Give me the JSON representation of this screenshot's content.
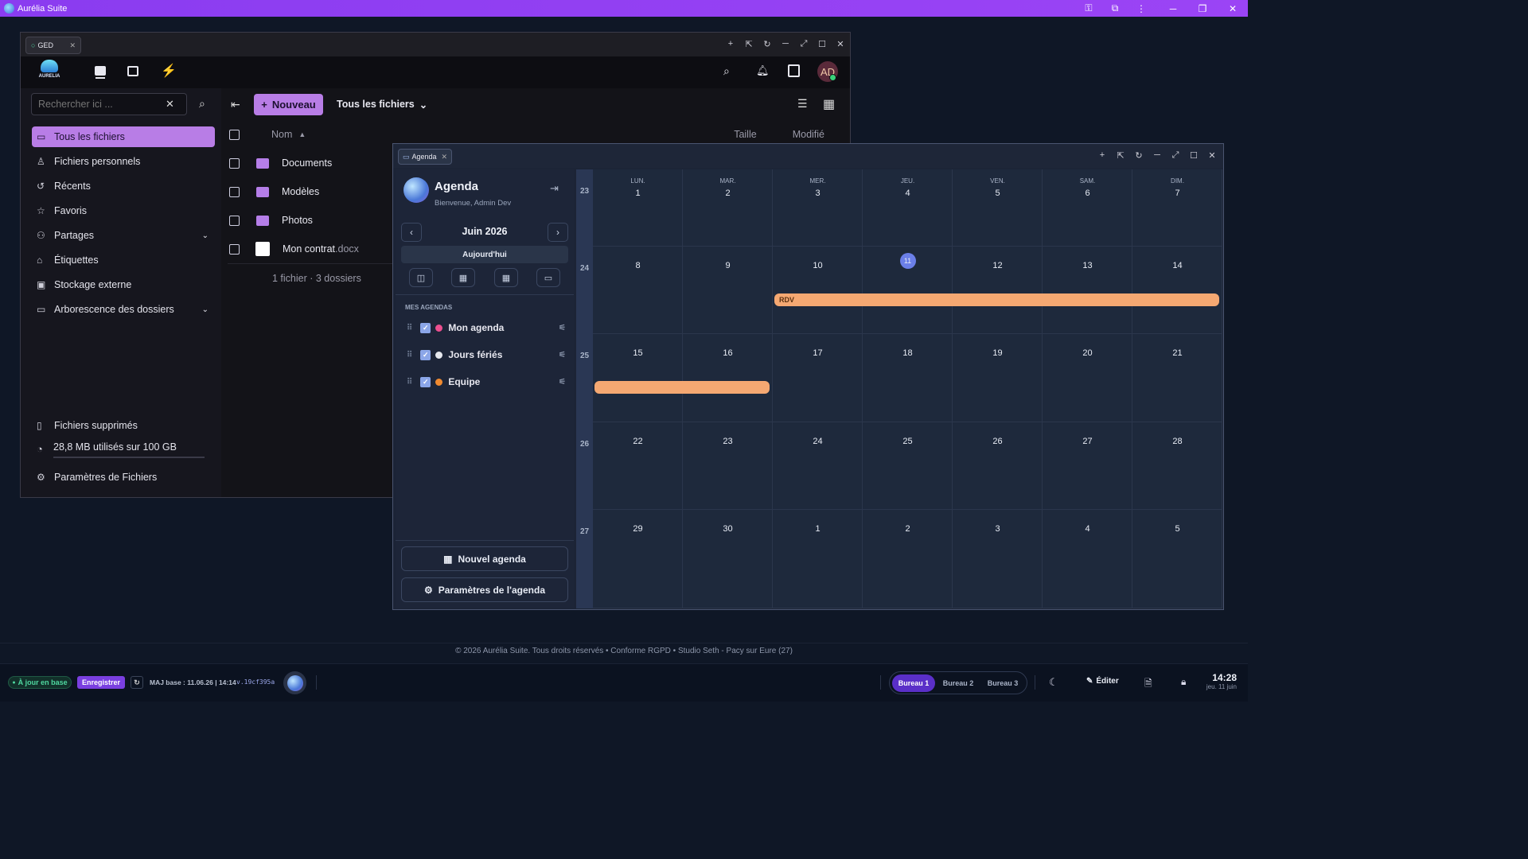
{
  "app": {
    "title": "Aurélia Suite"
  },
  "ged": {
    "tab_label": "GED",
    "brand": "AURELIA",
    "avatar": "AD",
    "search_placeholder": "Rechercher ici ...",
    "new_button": "Nouveau",
    "view_label": "Tous les fichiers",
    "nav": [
      {
        "label": "Tous les fichiers",
        "icon": "folder-icon"
      },
      {
        "label": "Fichiers personnels",
        "icon": "user-icon"
      },
      {
        "label": "Récents",
        "icon": "history-icon"
      },
      {
        "label": "Favoris",
        "icon": "star-icon"
      },
      {
        "label": "Partages",
        "icon": "share-icon"
      },
      {
        "label": "Étiquettes",
        "icon": "tag-icon"
      },
      {
        "label": "Stockage externe",
        "icon": "monitor-icon"
      },
      {
        "label": "Arborescence des dossiers",
        "icon": "folders-icon"
      }
    ],
    "trash_label": "Fichiers supprimés",
    "storage_label": "28,8 MB utilisés sur 100 GB",
    "storage_used_fraction": 0.0003,
    "settings_label": "Paramètres de Fichiers",
    "columns": {
      "name": "Nom",
      "size": "Taille",
      "modified": "Modifié"
    },
    "files": [
      {
        "name": "Documents",
        "ext": "",
        "type": "folder"
      },
      {
        "name": "Modèles",
        "ext": "",
        "type": "folder"
      },
      {
        "name": "Photos",
        "ext": "",
        "type": "folder"
      },
      {
        "name": "Mon contrat",
        "ext": ".docx",
        "type": "file"
      }
    ],
    "summary": "1 fichier · 3 dossiers"
  },
  "agenda": {
    "tab_label": "Agenda",
    "title": "Agenda",
    "welcome": "Bienvenue, Admin Dev",
    "month": "Juin 2026",
    "today_button": "Aujourd'hui",
    "section_label": "MES AGENDAS",
    "calendars": [
      {
        "name": "Mon agenda",
        "color": "#ec4f8f"
      },
      {
        "name": "Jours fériés",
        "color": "#e6e8ee"
      },
      {
        "name": "Equipe",
        "color": "#f08a30"
      }
    ],
    "new_button": "Nouvel agenda",
    "settings_button": "Paramètres de l'agenda",
    "weekdays": [
      "LUN.",
      "MAR.",
      "MER.",
      "JEU.",
      "VEN.",
      "SAM.",
      "DIM."
    ],
    "weeks": [
      {
        "num": "23",
        "days": [
          "1",
          "2",
          "3",
          "4",
          "5",
          "6",
          "7"
        ]
      },
      {
        "num": "24",
        "days": [
          "8",
          "9",
          "10",
          "11",
          "12",
          "13",
          "14"
        ]
      },
      {
        "num": "25",
        "days": [
          "15",
          "16",
          "17",
          "18",
          "19",
          "20",
          "21"
        ]
      },
      {
        "num": "26",
        "days": [
          "22",
          "23",
          "24",
          "25",
          "26",
          "27",
          "28"
        ]
      },
      {
        "num": "27",
        "days": [
          "29",
          "30",
          "1",
          "2",
          "3",
          "4",
          "5"
        ]
      }
    ],
    "today": "11",
    "events": [
      {
        "label": "RDV",
        "color": "#f5a872"
      },
      {
        "label": "",
        "color": "#f5a872"
      }
    ]
  },
  "footer": {
    "text": "© 2026 Aurélia Suite. Tous droits réservés • Conforme RGPD • Studio Seth - Pacy sur Eure (27)"
  },
  "taskbar": {
    "status": "À jour en base",
    "save": "Enregistrer",
    "update": "MAJ base : 11.06.26 | 14:14",
    "version": "v.19cf395a",
    "desktops": [
      "Bureau 1",
      "Bureau 2",
      "Bureau 3"
    ],
    "edit": "Éditer",
    "time": "14:28",
    "date": "jeu. 11 juin"
  }
}
